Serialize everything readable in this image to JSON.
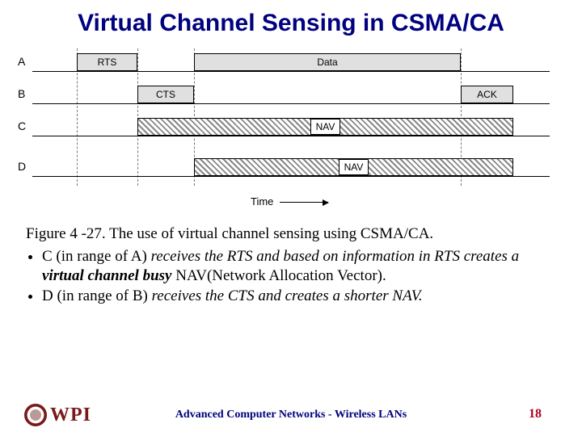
{
  "title": "Virtual Channel Sensing in CSMA/CA",
  "diagram": {
    "rows": {
      "A": "A",
      "B": "B",
      "C": "C",
      "D": "D"
    },
    "boxes": {
      "rts": "RTS",
      "cts": "CTS",
      "data": "Data",
      "ack": "ACK",
      "navC": "NAV",
      "navD": "NAV"
    },
    "time": "Time"
  },
  "caption": "Figure 4 -27. The use of virtual channel sensing using CSMA/CA.",
  "bullets": [
    {
      "pre": "C (in range of A) ",
      "italic1": "receives the RTS and  based on information in RTS creates a ",
      "boldit": "virtual channel busy ",
      "post": "NAV(Network Allocation Vector)."
    },
    {
      "pre": "D (in range of B) ",
      "italic1": "receives the CTS and creates a shorter NAV.",
      "boldit": "",
      "post": ""
    }
  ],
  "footer": {
    "org": "WPI",
    "center": "Advanced Computer Networks - Wireless LANs",
    "page": "18"
  }
}
